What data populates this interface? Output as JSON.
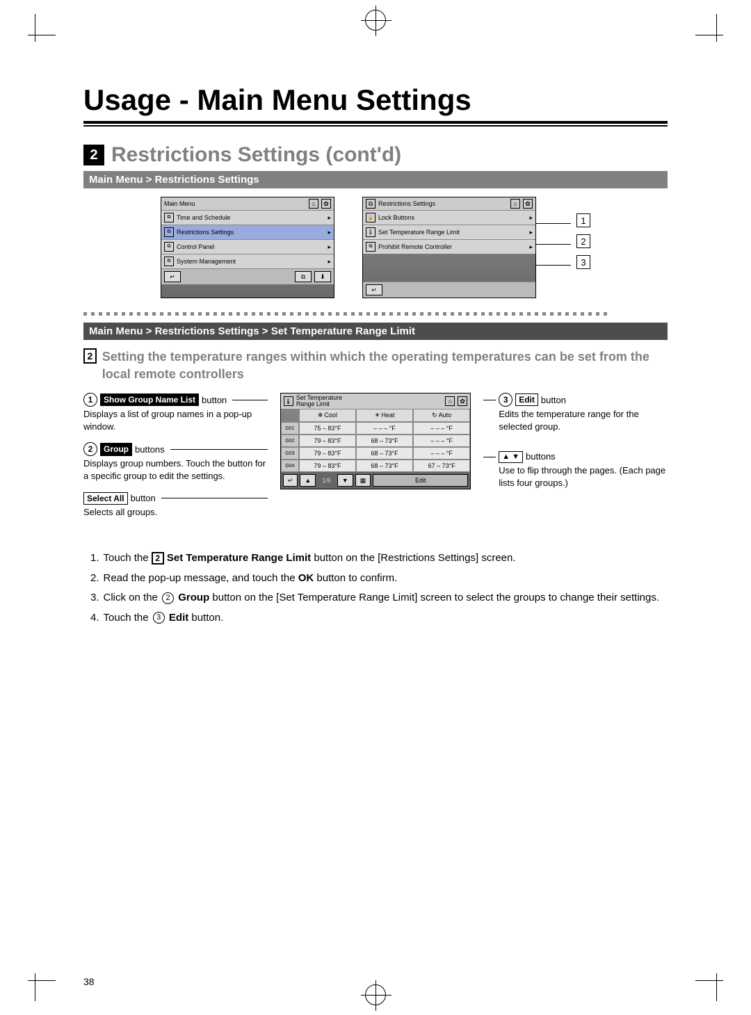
{
  "page": {
    "number": "38",
    "title": "Usage - Main Menu Settings",
    "section_number": "2",
    "section_title": "Restrictions Settings (cont'd)"
  },
  "crumb1": "Main Menu > Restrictions Settings",
  "crumb2": "Main Menu > Restrictions Settings > Set Temperature Range Limit",
  "main_menu_screen": {
    "title": "Main Menu",
    "items": [
      "Time and Schedule",
      "Restrictions Settings",
      "Control Panel",
      "System Management"
    ]
  },
  "restrictions_screen": {
    "title": "Restrictions Settings",
    "items": [
      "Lock Buttons",
      "Set Temperature Range Limit",
      "Prohibit Remote Controller"
    ]
  },
  "right_callouts": [
    "1",
    "2",
    "3"
  ],
  "sub_number": "2",
  "sub_heading": "Setting the temperature ranges within which the operating temperatures can be set from the local remote controllers",
  "left_notes": {
    "n1": {
      "circ": "1",
      "label": "Show Group Name List",
      "suffix": "button",
      "desc": "Displays a list of group names in a pop-up window."
    },
    "n2": {
      "circ": "2",
      "label": "Group",
      "suffix": "buttons",
      "desc": "Displays group numbers. Touch the button for a specific group to edit the settings."
    },
    "n3": {
      "label": "Select All",
      "suffix": "button",
      "desc": "Selects all groups."
    }
  },
  "right_notes": {
    "n1": {
      "circ": "3",
      "label": "Edit",
      "suffix": "button",
      "desc": "Edits the temperature range for the selected group."
    },
    "n2": {
      "label_arrows": "▲ ▼",
      "suffix": "buttons",
      "desc": "Use to flip through the pages. (Each page lists four groups.)"
    }
  },
  "temp_screen": {
    "title_l1": "Set Temperature",
    "title_l2": "Range Limit",
    "tabs": [
      {
        "sym": "❄",
        "label": "Cool"
      },
      {
        "sym": "☀",
        "label": "Heat"
      },
      {
        "sym": "↻",
        "label": "Auto"
      }
    ],
    "rows": [
      {
        "g": "G01",
        "cool": "75 – 83°F",
        "heat": "– – – °F",
        "auto": "– – – °F"
      },
      {
        "g": "G02",
        "cool": "79 – 83°F",
        "heat": "68 – 73°F",
        "auto": "– – – °F"
      },
      {
        "g": "G03",
        "cool": "79 – 83°F",
        "heat": "68 – 73°F",
        "auto": "– – – °F"
      },
      {
        "g": "G04",
        "cool": "79 – 83°F",
        "heat": "68 – 73°F",
        "auto": "67 – 73°F"
      }
    ],
    "pager": "1/6",
    "edit": "Edit"
  },
  "steps": {
    "s1a": "Touch the ",
    "s1_box": "2",
    "s1_bold": "Set Temperature Range Limit",
    "s1b": " button on the [Restrictions Settings] screen.",
    "s2": "Read the pop-up message, and touch the ",
    "s2_bold": "OK",
    "s2b": " button to confirm.",
    "s3a": "Click on the ",
    "s3_circ": "2",
    "s3_bold": "Group",
    "s3b": " button on the [Set Temperature Range Limit] screen to select the groups to change their settings.",
    "s4a": "Touch the ",
    "s4_circ": "3",
    "s4_bold": "Edit",
    "s4b": " button."
  }
}
